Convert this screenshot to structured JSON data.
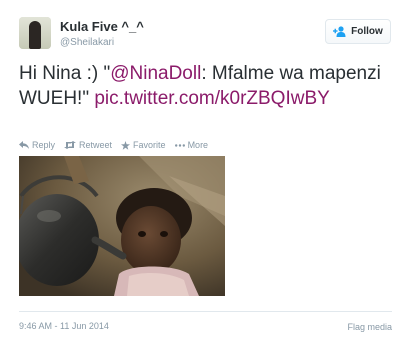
{
  "author": {
    "display_name": "Kula Five ^_^",
    "handle": "@Sheilakari"
  },
  "follow_button": {
    "label": "Follow",
    "icon": "person-add-icon"
  },
  "tweet": {
    "prefix": "Hi Nina :)  \"",
    "mention": "@NinaDoll",
    "body": ": Mfalme wa mapenzi WUEH!\"",
    "media_link": "pic.twitter.com/k0rZBQIwBY"
  },
  "actions": [
    {
      "label": "Reply",
      "icon": "reply-icon"
    },
    {
      "label": "Retweet",
      "icon": "retweet-icon"
    },
    {
      "label": "Favorite",
      "icon": "star-icon"
    },
    {
      "label": "More",
      "icon": "more-dots-icon"
    }
  ],
  "footer": {
    "timestamp": "9:46 AM - 11 Jun 2014",
    "flag_label": "Flag media"
  },
  "colors": {
    "link": "#8b1b6a",
    "muted": "#8899a6",
    "text": "#292f33"
  }
}
